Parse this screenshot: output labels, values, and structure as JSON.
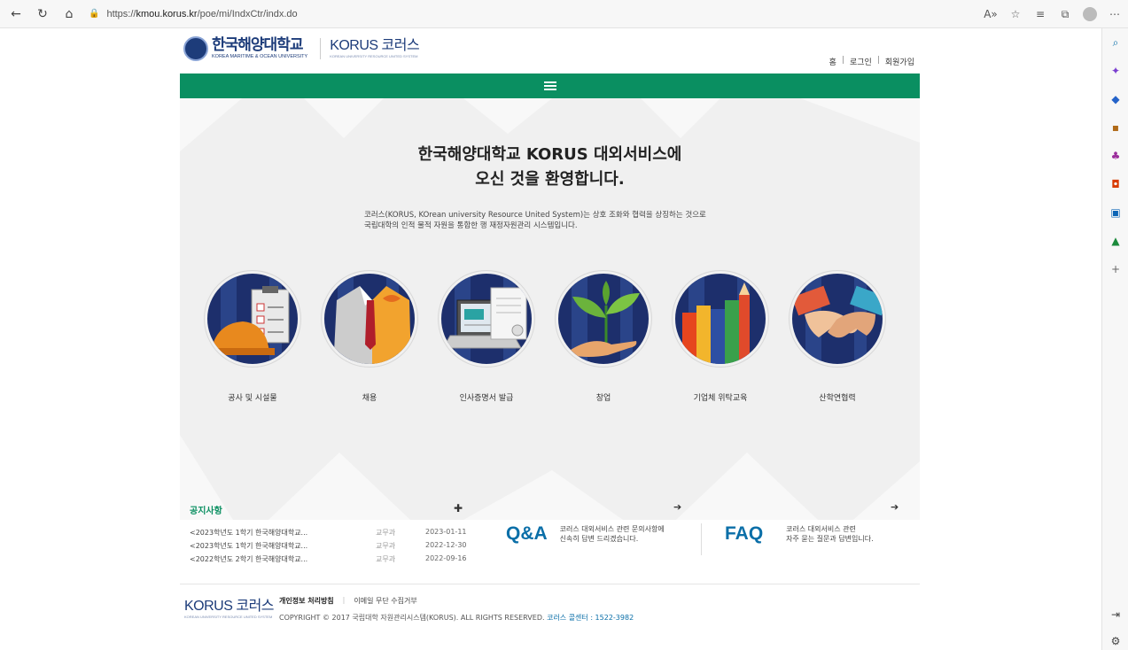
{
  "browser": {
    "url_prefix": "https://",
    "url_domain": "kmou.korus.kr",
    "url_path": "/poe/mi/IndxCtr/indx.do"
  },
  "header": {
    "univ_name_ko": "한국해양대학교",
    "univ_name_en": "KOREA MARITIME & OCEAN UNIVERSITY",
    "korus_name": "KORUS 코러스",
    "korus_sub": "KOREAN UNIVERSITY RESOURCE UNITED SYSTEM",
    "links": [
      "홈",
      "로그인",
      "회원가입"
    ]
  },
  "hero": {
    "title_line1": "한국해양대학교 KORUS 대외서비스에",
    "title_line2": "오신 것을 환영합니다.",
    "desc_line1": "코러스(KORUS, KOrean university Resource United System)는 상호 조화와 협력을 상징하는 것으로",
    "desc_line2": "국립대학의 인적 물적 자원을 통합한 행 재정자원관리 시스템입니다."
  },
  "services": [
    {
      "label": "공사 및 시설물",
      "icon": "construction-checklist-icon"
    },
    {
      "label": "채용",
      "icon": "hiring-suit-icon"
    },
    {
      "label": "인사증명서 발급",
      "icon": "certificate-laptop-icon"
    },
    {
      "label": "창업",
      "icon": "startup-sprout-icon"
    },
    {
      "label": "기업체 위탁교육",
      "icon": "education-books-icon"
    },
    {
      "label": "산학연협력",
      "icon": "handshake-icon"
    }
  ],
  "notice": {
    "title": "공지사항",
    "rows": [
      {
        "title": "<2023학년도 1학기 한국해양대학교...",
        "dept": "교무과",
        "date": "2023-01-11"
      },
      {
        "title": "<2023학년도 1학기 한국해양대학교...",
        "dept": "교무과",
        "date": "2022-12-30"
      },
      {
        "title": "<2022학년도 2학기 한국해양대학교...",
        "dept": "교무과",
        "date": "2022-09-16"
      }
    ]
  },
  "qa": {
    "title": "Q&A",
    "desc_line1": "코러스 대외서비스 관련 문의사항에",
    "desc_line2": "신속히 답변 드리겠습니다."
  },
  "faq": {
    "title": "FAQ",
    "desc_line1": "코러스 대외서비스 관련",
    "desc_line2": "자주 묻는 질문과 답변입니다."
  },
  "footer": {
    "privacy": "개인정보 처리방침",
    "email": "이메일 무단 수집거부",
    "copyright": "COPYRIGHT © 2017 국립대학 자원관리시스템(KORUS). ALL RIGHTS RESERVED.",
    "callcenter": "코러스 콜센터 : 1522-3982"
  },
  "colors": {
    "green": "#0a8f61",
    "navy": "#1d3c7a",
    "link_blue": "#0b6fa8"
  }
}
